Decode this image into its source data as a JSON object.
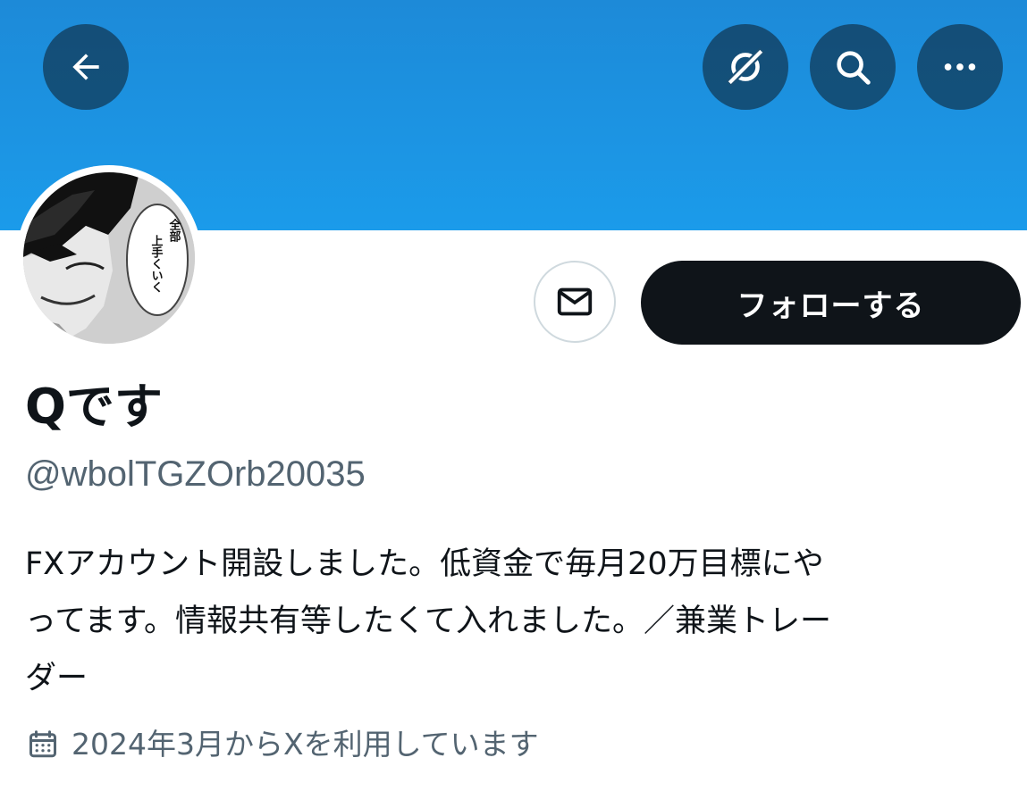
{
  "header": {
    "back_icon": "arrow-left-icon",
    "grok_icon": "grok-icon",
    "search_icon": "search-icon",
    "more_icon": "more-horizontal-icon",
    "banner_color": "#1d95e6"
  },
  "avatar": {
    "speech_text": "全部上手くいく"
  },
  "actions": {
    "message_icon": "mail-icon",
    "follow_label": "フォローする",
    "follow_bg": "#0f1419"
  },
  "profile": {
    "display_name": "Qです",
    "handle": "@wbolTGZOrb20035",
    "bio_lines": [
      "FXアカウント開設しました。低資金で毎月20万目標にや",
      "ってます。情報共有等したくて入れました。／兼業トレー",
      "ダー"
    ],
    "joined_icon": "calendar-icon",
    "joined_text": "2024年3月からXを利用しています"
  }
}
